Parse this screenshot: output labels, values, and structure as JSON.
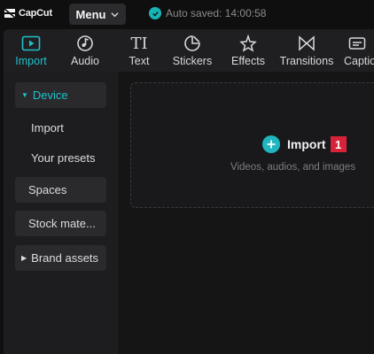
{
  "app": {
    "logo_text": "CapCut",
    "menu_label": "Menu",
    "autosave_text": "Auto saved: 14:00:58"
  },
  "toolbar": {
    "tabs": [
      {
        "label": "Import",
        "icon": "import-icon",
        "active": true
      },
      {
        "label": "Audio",
        "icon": "audio-icon"
      },
      {
        "label": "Text",
        "icon": "text-icon"
      },
      {
        "label": "Stickers",
        "icon": "stickers-icon"
      },
      {
        "label": "Effects",
        "icon": "effects-icon"
      },
      {
        "label": "Transitions",
        "icon": "transitions-icon"
      },
      {
        "label": "Captio",
        "icon": "captions-icon"
      }
    ]
  },
  "sidebar": {
    "items": [
      {
        "label": "Device",
        "expanded": true
      },
      {
        "label": "Import"
      },
      {
        "label": "Your presets"
      },
      {
        "label": "Spaces"
      },
      {
        "label": "Stock mate..."
      },
      {
        "label": "Brand assets",
        "expanded": false
      }
    ]
  },
  "import_area": {
    "button_label": "Import",
    "badge": "1",
    "hint": "Videos, audios, and images"
  },
  "colors": {
    "accent": "#20c0c8",
    "badge": "#d6233a",
    "background": "#0f0f10"
  }
}
